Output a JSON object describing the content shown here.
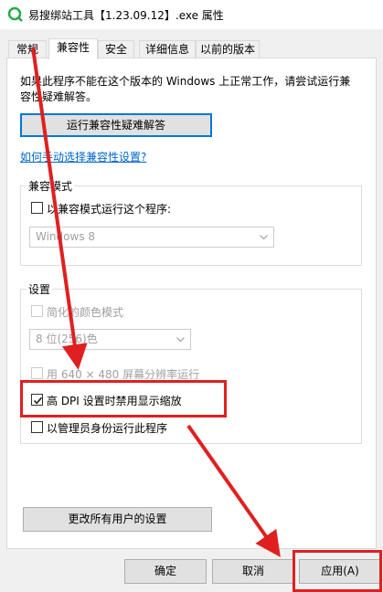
{
  "window": {
    "title": "易搜绑站工具【1.23.09.12】.exe 属性"
  },
  "tabs": [
    {
      "label": "常规"
    },
    {
      "label": "兼容性"
    },
    {
      "label": "安全"
    },
    {
      "label": "详细信息"
    },
    {
      "label": "以前的版本"
    }
  ],
  "compat": {
    "description": "如果此程序不能在这个版本的 Windows 上正常工作，请尝试运行兼容性疑难解答。",
    "troubleshoot_button": "运行兼容性疑难解答",
    "manual_link": "如何手动选择兼容性设置?"
  },
  "compat_mode": {
    "group_label": "兼容模式",
    "checkbox_label": "以兼容模式运行这个程序:",
    "checked": false,
    "os_select": "Windows 8"
  },
  "settings": {
    "group_label": "设置",
    "reduced_color": {
      "label": "简化的颜色模式",
      "checked": false
    },
    "color_select": "8 位(256)色",
    "resolution_640": {
      "label": "用 640 × 480 屏幕分辨率运行",
      "checked": false
    },
    "high_dpi": {
      "label": "高 DPI 设置时禁用显示缩放",
      "checked": true
    },
    "run_as_admin": {
      "label": "以管理员身份运行此程序",
      "checked": false
    }
  },
  "all_users_button": "更改所有用户的设置",
  "buttons": {
    "ok": "确定",
    "cancel": "取消",
    "apply": "应用(A)"
  },
  "colors": {
    "annotation_red": "#e02020",
    "focus_blue": "#0078d7",
    "link_blue": "#0066cc"
  }
}
